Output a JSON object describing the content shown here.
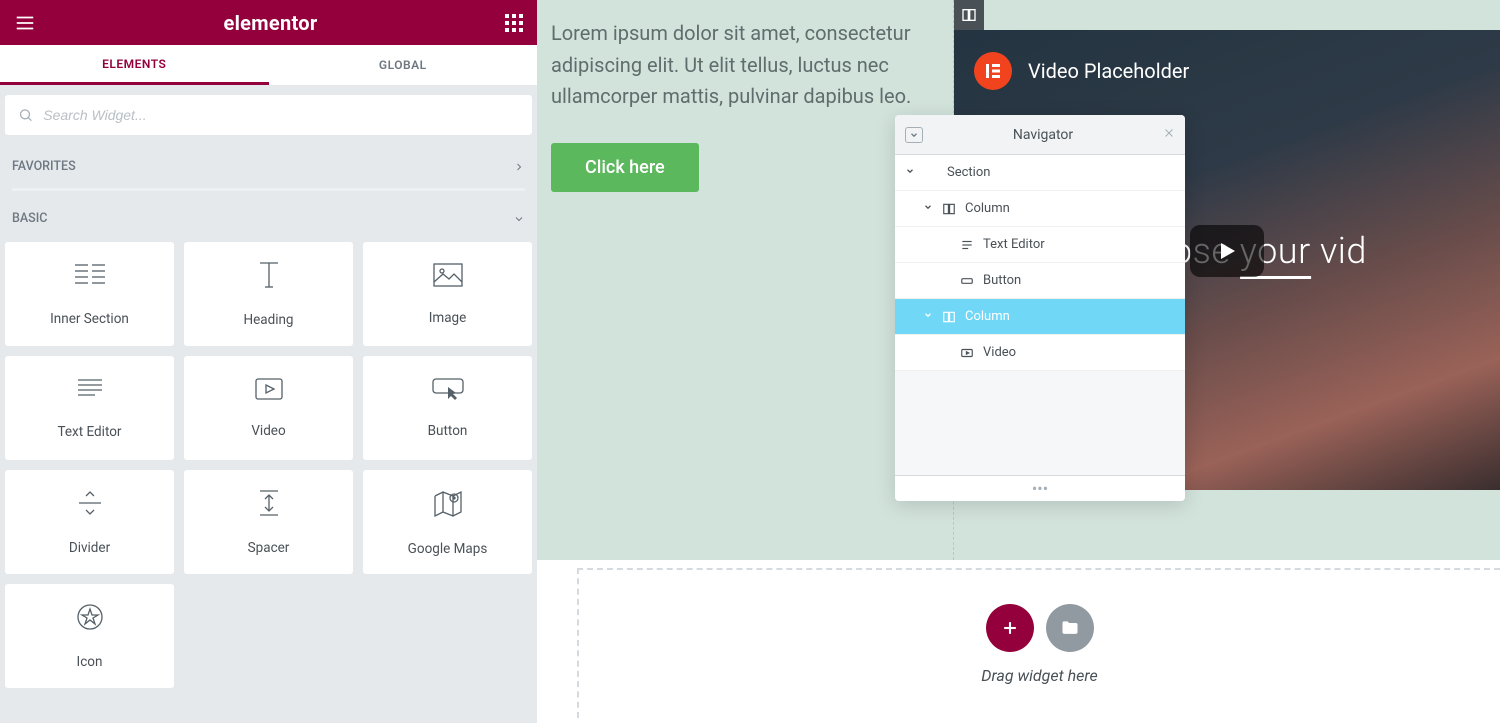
{
  "panel": {
    "brand": "elementor",
    "tabs": {
      "elements": "ELEMENTS",
      "global": "GLOBAL"
    },
    "search_placeholder": "Search Widget...",
    "cat_favorites": "FAVORITES",
    "cat_basic": "BASIC",
    "widgets": [
      "Inner Section",
      "Heading",
      "Image",
      "Text Editor",
      "Video",
      "Button",
      "Divider",
      "Spacer",
      "Google Maps",
      "Icon"
    ]
  },
  "canvas": {
    "text": "Lorem ipsum dolor sit amet, consectetur adipiscing elit. Ut elit tellus, luctus nec ullamcorper mattis, pulvinar dapibus leo.",
    "button": "Click here",
    "video_title": "Video Placeholder",
    "video_caption_prefix": "Choose ",
    "video_caption_underline": "your",
    "video_caption_suffix": " vid",
    "drop_text": "Drag widget here"
  },
  "navigator": {
    "title": "Navigator",
    "items": [
      {
        "label": "Section",
        "depth": 0,
        "icon": "",
        "expandable": true
      },
      {
        "label": "Column",
        "depth": 1,
        "icon": "column",
        "expandable": true
      },
      {
        "label": "Text Editor",
        "depth": 2,
        "icon": "text",
        "expandable": false
      },
      {
        "label": "Button",
        "depth": 2,
        "icon": "button",
        "expandable": false
      },
      {
        "label": "Column",
        "depth": 1,
        "icon": "column",
        "expandable": true,
        "selected": true
      },
      {
        "label": "Video",
        "depth": 2,
        "icon": "video",
        "expandable": false
      }
    ]
  }
}
